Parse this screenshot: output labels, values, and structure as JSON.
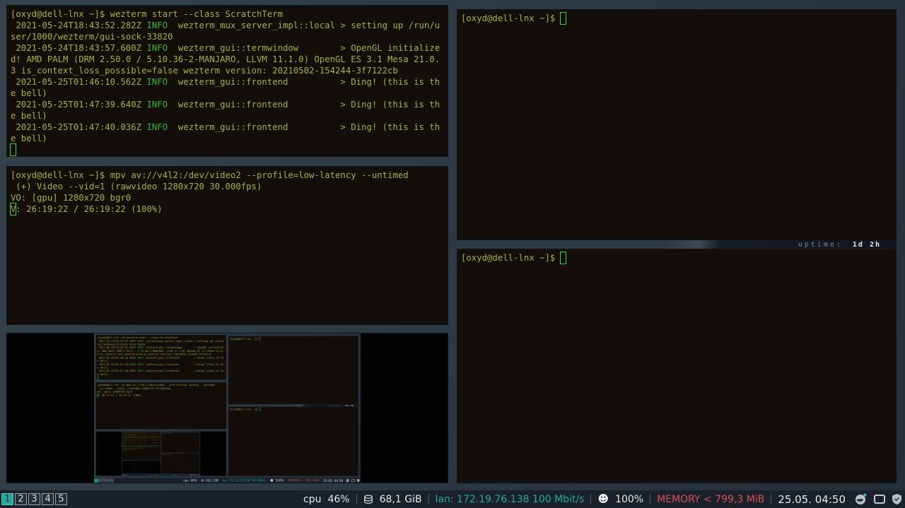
{
  "colors": {
    "wallpaper": "#2d3941",
    "term_bg": "#130e09",
    "term_fg": "#a8b04a",
    "info_green": "#3db53d",
    "cursor_green": "#3fd142",
    "bar_bg": "#1a212a",
    "accent_teal": "#2aa89b",
    "warn_red": "#d84f55"
  },
  "terminals": {
    "wezterm_log": {
      "lines": [
        [
          {
            "t": "[oxyd@dell-lnx ~]$ wezterm start --class ScratchTerm",
            "c": "fg"
          }
        ],
        [
          {
            "t": " 2021-05-24T18:43:52.282Z ",
            "c": "fg"
          },
          {
            "t": "INFO",
            "c": "info"
          },
          {
            "t": "  wezterm_mux_server_impl::local > setting up /run/u",
            "c": "fg"
          }
        ],
        [
          {
            "t": "ser/1000/wezterm/gui-sock-33820",
            "c": "fg"
          }
        ],
        [
          {
            "t": " 2021-05-24T18:43:57.600Z ",
            "c": "fg"
          },
          {
            "t": "INFO",
            "c": "info"
          },
          {
            "t": "  wezterm_gui::termwindow        > OpenGL initialize",
            "c": "fg"
          }
        ],
        [
          {
            "t": "d! AMD PALM (DRM 2.50.0 / 5.10.36-2-MANJARO, LLVM 11.1.0) OpenGL ES 3.1 Mesa 21.0.",
            "c": "fg"
          }
        ],
        [
          {
            "t": "3 is_context_loss_possible=false wezterm version: 20210502-154244-3f7122cb",
            "c": "fg"
          }
        ],
        [
          {
            "t": " 2021-05-25T01:46:10.562Z ",
            "c": "fg"
          },
          {
            "t": "INFO",
            "c": "info"
          },
          {
            "t": "  wezterm_gui::frontend          > Ding! (this is th",
            "c": "fg"
          }
        ],
        [
          {
            "t": "e bell)",
            "c": "fg"
          }
        ],
        [
          {
            "t": " 2021-05-25T01:47:39.640Z ",
            "c": "fg"
          },
          {
            "t": "INFO",
            "c": "info"
          },
          {
            "t": "  wezterm_gui::frontend          > Ding! (this is th",
            "c": "fg"
          }
        ],
        [
          {
            "t": "e bell)",
            "c": "fg"
          }
        ],
        [
          {
            "t": " 2021-05-25T01:47:40.036Z ",
            "c": "fg"
          },
          {
            "t": "INFO",
            "c": "info"
          },
          {
            "t": "  wezterm_gui::frontend          > Ding! (this is th",
            "c": "fg"
          }
        ],
        [
          {
            "t": "e bell)",
            "c": "fg"
          }
        ],
        [
          {
            "t": " ",
            "c": "cursor"
          }
        ]
      ]
    },
    "mpv": {
      "lines": [
        [
          {
            "t": "[oxyd@dell-lnx ~]$ mpv av://v4l2:/dev/video2 --profile=low-latency --untimed",
            "c": "fg"
          }
        ],
        [
          {
            "t": " (+) Video --vid=1 (rawvideo 1280x720 30.000fps)",
            "c": "fg"
          }
        ],
        [
          {
            "t": "VO: [gpu] 1280x720 bgr0",
            "c": "fg"
          }
        ],
        [
          {
            "t": "V",
            "c": "cursor"
          },
          {
            "t": ": 26:19:22 / 26:19:22 (100%)",
            "c": "fg"
          }
        ]
      ]
    },
    "right_top": {
      "lines": [
        [
          {
            "t": "[oxyd@dell-lnx ~]$ ",
            "c": "fg"
          },
          {
            "t": " ",
            "c": "cursor"
          }
        ]
      ]
    },
    "right_bottom": {
      "lines": [
        [
          {
            "t": "[oxyd@dell-lnx ~]$ ",
            "c": "fg"
          },
          {
            "t": " ",
            "c": "cursor"
          }
        ]
      ]
    }
  },
  "uptime": {
    "label": "uptime:",
    "value": "1d 2h"
  },
  "taskbar": {
    "workspaces": [
      "1",
      "2",
      "3",
      "4",
      "5"
    ],
    "active_workspace": "1",
    "cpu_label": "cpu",
    "cpu_value": "46%",
    "disk_icon": "database-cylinder",
    "mem_used": "68,1 GiB",
    "lan_text": "lan: 172.19.76.138 100 Mbit/s",
    "battery_icon": "☻",
    "battery_value": "100%",
    "memory_warning": "MEMORY < 799,3 MiB",
    "clock": "25.05. 04:50",
    "tray_icons": [
      "nextcloud-cloud",
      "window-frame",
      "shield-check"
    ]
  }
}
